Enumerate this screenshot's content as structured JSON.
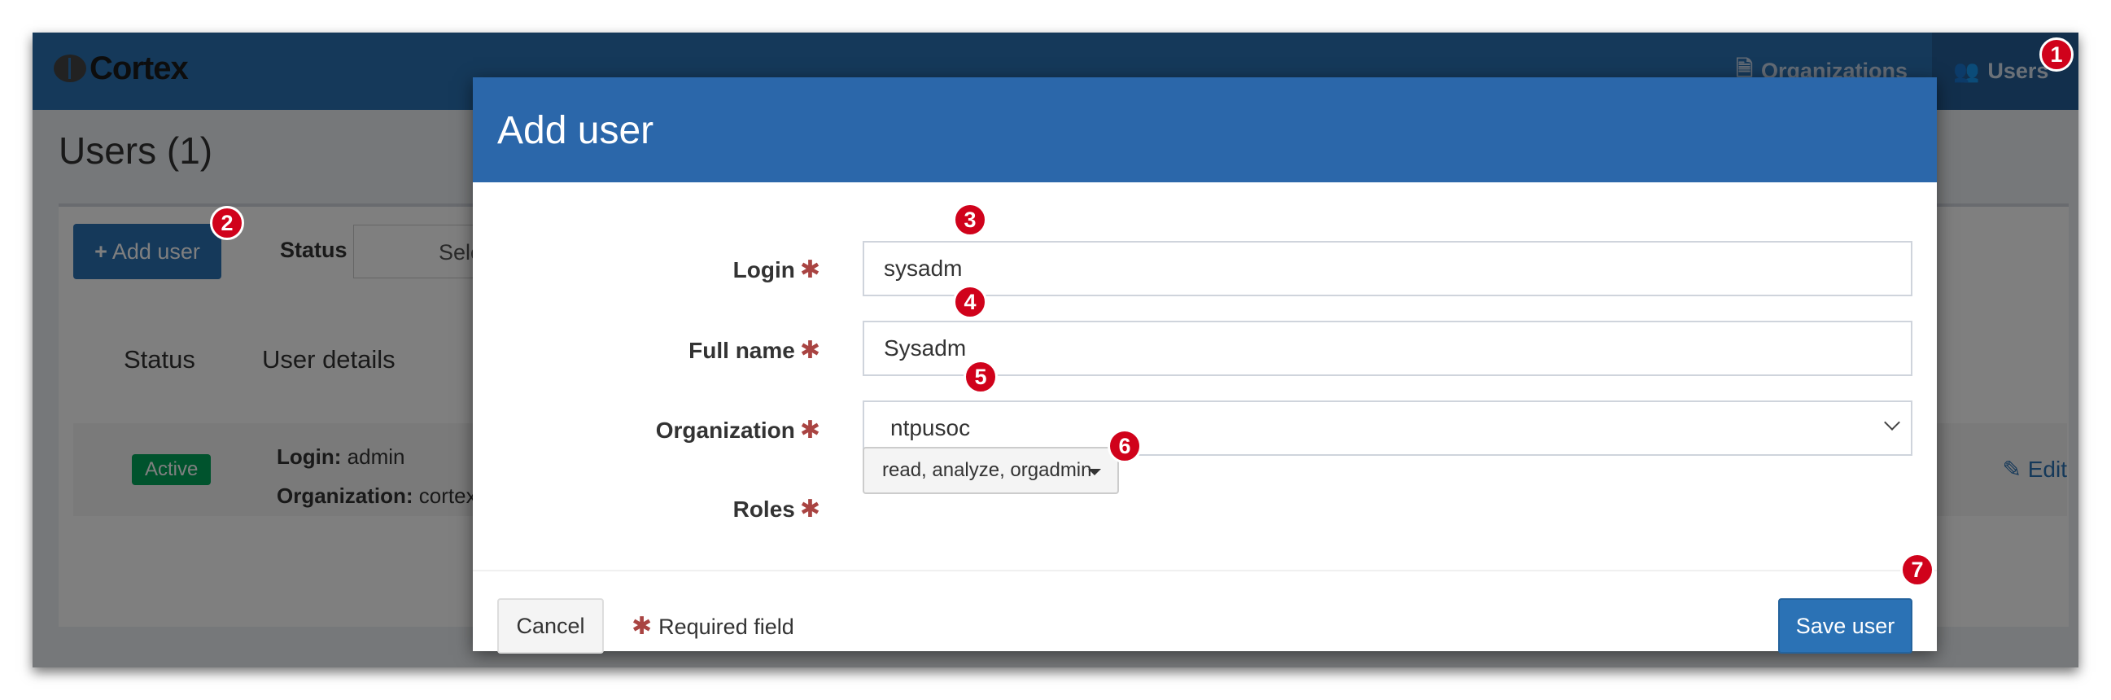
{
  "app": {
    "brand": "Cortex"
  },
  "nav": {
    "organizations_label": "Organizations",
    "users_label": "Users"
  },
  "page": {
    "title": "Users (1)"
  },
  "toolbar": {
    "add_user_label": "Add user",
    "status_label": "Status",
    "status_select_value": "Sele"
  },
  "table": {
    "headers": [
      "Status",
      "User details"
    ],
    "rows": [
      {
        "status": "Active",
        "login_label": "Login:",
        "login": "admin",
        "org_label": "Organization:",
        "organization": "cortex",
        "edit_label": "Edit"
      }
    ]
  },
  "modal": {
    "title": "Add user",
    "fields": {
      "login": {
        "label": "Login",
        "value": "sysadm"
      },
      "full_name": {
        "label": "Full name",
        "value": "Sysadm"
      },
      "organization": {
        "label": "Organization",
        "value": "ntpusoc"
      },
      "roles": {
        "label": "Roles",
        "value": "read, analyze, orgadmin"
      }
    },
    "required_symbol": "✱",
    "required_note": "Required field",
    "cancel_label": "Cancel",
    "save_label": "Save user"
  },
  "markers": [
    "1",
    "2",
    "3",
    "4",
    "5",
    "6",
    "7"
  ],
  "colors": {
    "primary": "#2b72b5",
    "modal_header": "#2b67aa",
    "required": "#a94442",
    "active_badge": "#00a65a",
    "marker": "#d0021b"
  }
}
